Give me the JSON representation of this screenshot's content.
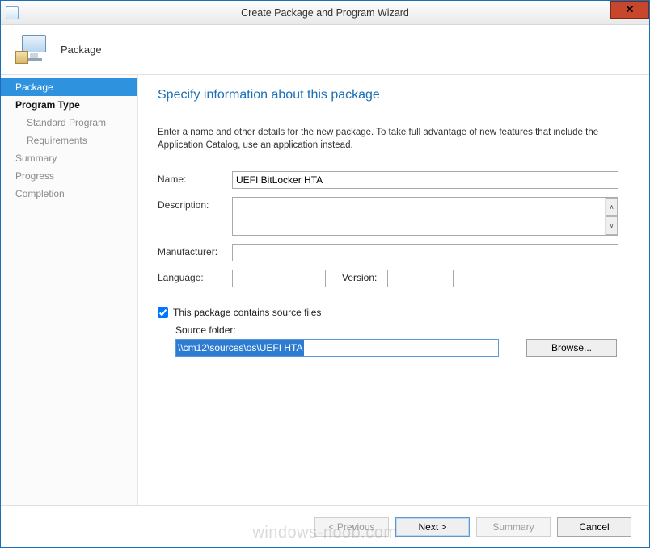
{
  "window": {
    "title": "Create Package and Program Wizard"
  },
  "header": {
    "label": "Package"
  },
  "sidebar": {
    "items": [
      {
        "label": "Package",
        "sel": true
      },
      {
        "label": "Program Type",
        "bold": true
      },
      {
        "label": "Standard Program",
        "sub": true
      },
      {
        "label": "Requirements",
        "sub": true
      },
      {
        "label": "Summary",
        "grey": true
      },
      {
        "label": "Progress",
        "grey": true
      },
      {
        "label": "Completion",
        "grey": true
      }
    ]
  },
  "content": {
    "heading": "Specify information about this package",
    "intro": "Enter a name and other details for the new package. To take full advantage of new features that include the Application Catalog, use an application instead.",
    "labels": {
      "name": "Name:",
      "description": "Description:",
      "manufacturer": "Manufacturer:",
      "language": "Language:",
      "version": "Version:",
      "contains_source": "This package contains source files",
      "source_folder": "Source folder:",
      "browse": "Browse..."
    },
    "values": {
      "name": "UEFI BitLocker HTA",
      "description": "",
      "manufacturer": "",
      "language": "",
      "version": "",
      "contains_source_checked": true,
      "source_folder": "\\\\cm12\\sources\\os\\UEFI HTA"
    }
  },
  "footer": {
    "previous": "< Previous",
    "next": "Next >",
    "summary": "Summary",
    "cancel": "Cancel"
  },
  "watermark": "windows-noob.com"
}
